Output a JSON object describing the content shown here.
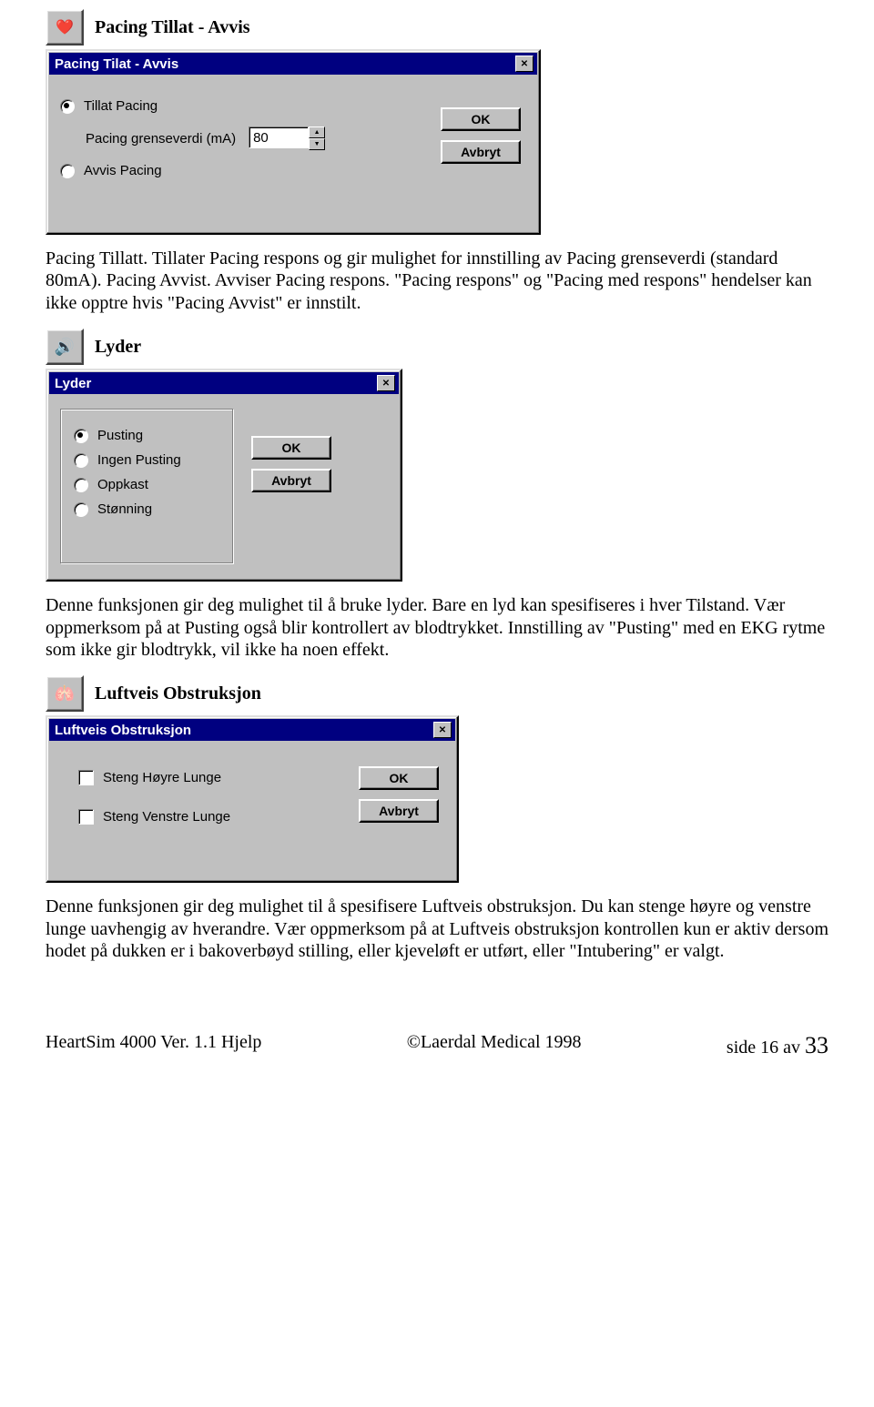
{
  "section1": {
    "title": "Pacing Tillat - Avvis",
    "dialog": {
      "title": "Pacing Tilat - Avvis",
      "opt_allow": "Tillat Pacing",
      "threshold_label": "Pacing grenseverdi (mA)",
      "threshold_value": "80",
      "opt_deny": "Avvis Pacing",
      "ok": "OK",
      "cancel": "Avbryt"
    },
    "para": "Pacing Tillatt. Tillater Pacing respons og gir mulighet for innstilling av Pacing grenseverdi (standard 80mA). Pacing Avvist. Avviser Pacing respons. \"Pacing respons\" og \"Pacing med respons\" hendelser kan ikke opptre hvis \"Pacing Avvist\" er innstilt."
  },
  "section2": {
    "title": "Lyder",
    "dialog": {
      "title": "Lyder",
      "opt1": "Pusting",
      "opt2": "Ingen Pusting",
      "opt3": "Oppkast",
      "opt4": "Stønning",
      "ok": "OK",
      "cancel": "Avbryt"
    },
    "para": "Denne funksjonen gir deg mulighet til å bruke lyder. Bare en lyd kan spesifiseres i hver Tilstand. Vær oppmerksom på at Pusting også blir kontrollert av blodtrykket. Innstilling av \"Pusting\" med en EKG rytme som ikke gir blodtrykk, vil ikke ha noen effekt."
  },
  "section3": {
    "title": "Luftveis Obstruksjon",
    "dialog": {
      "title": "Luftveis Obstruksjon",
      "chk1": "Steng Høyre Lunge",
      "chk2": "Steng Venstre Lunge",
      "ok": "OK",
      "cancel": "Avbryt"
    },
    "para": "Denne funksjonen gir deg mulighet til å spesifisere Luftveis obstruksjon. Du kan stenge høyre og venstre lunge uavhengig av hverandre. Vær oppmerksom på at Luftveis obstruksjon kontrollen kun er aktiv dersom hodet på dukken er i bakoverbøyd stilling, eller kjeveløft er utført, eller \"Intubering\" er valgt."
  },
  "footer": {
    "left": "HeartSim 4000 Ver.  1.1 Hjelp",
    "center": "©Laerdal Medical  1998",
    "right_prefix": "side 16 av ",
    "right_total": "33"
  }
}
